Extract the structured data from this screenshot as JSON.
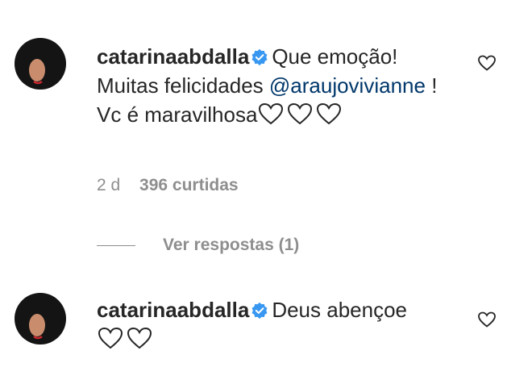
{
  "comments": [
    {
      "username": "catarinaabdalla",
      "verified": true,
      "text_prefix": "Que emoção! Muitas felicidades",
      "mention": "@araujovivianne",
      "text_suffix": "! Vc é maravilhosa",
      "inline_hearts": 3,
      "timestamp": "2 d",
      "likes": "396 curtidas",
      "view_replies": "Ver respostas (1)"
    },
    {
      "username": "catarinaabdalla",
      "verified": true,
      "text": "Deus abençoe",
      "inline_hearts": 2
    }
  ],
  "colors": {
    "text": "#262626",
    "secondary": "#8e8e8e",
    "mention": "#00376b",
    "verified": "#3897f0"
  },
  "icons": [
    "verified-badge-icon",
    "heart-outline-icon"
  ]
}
